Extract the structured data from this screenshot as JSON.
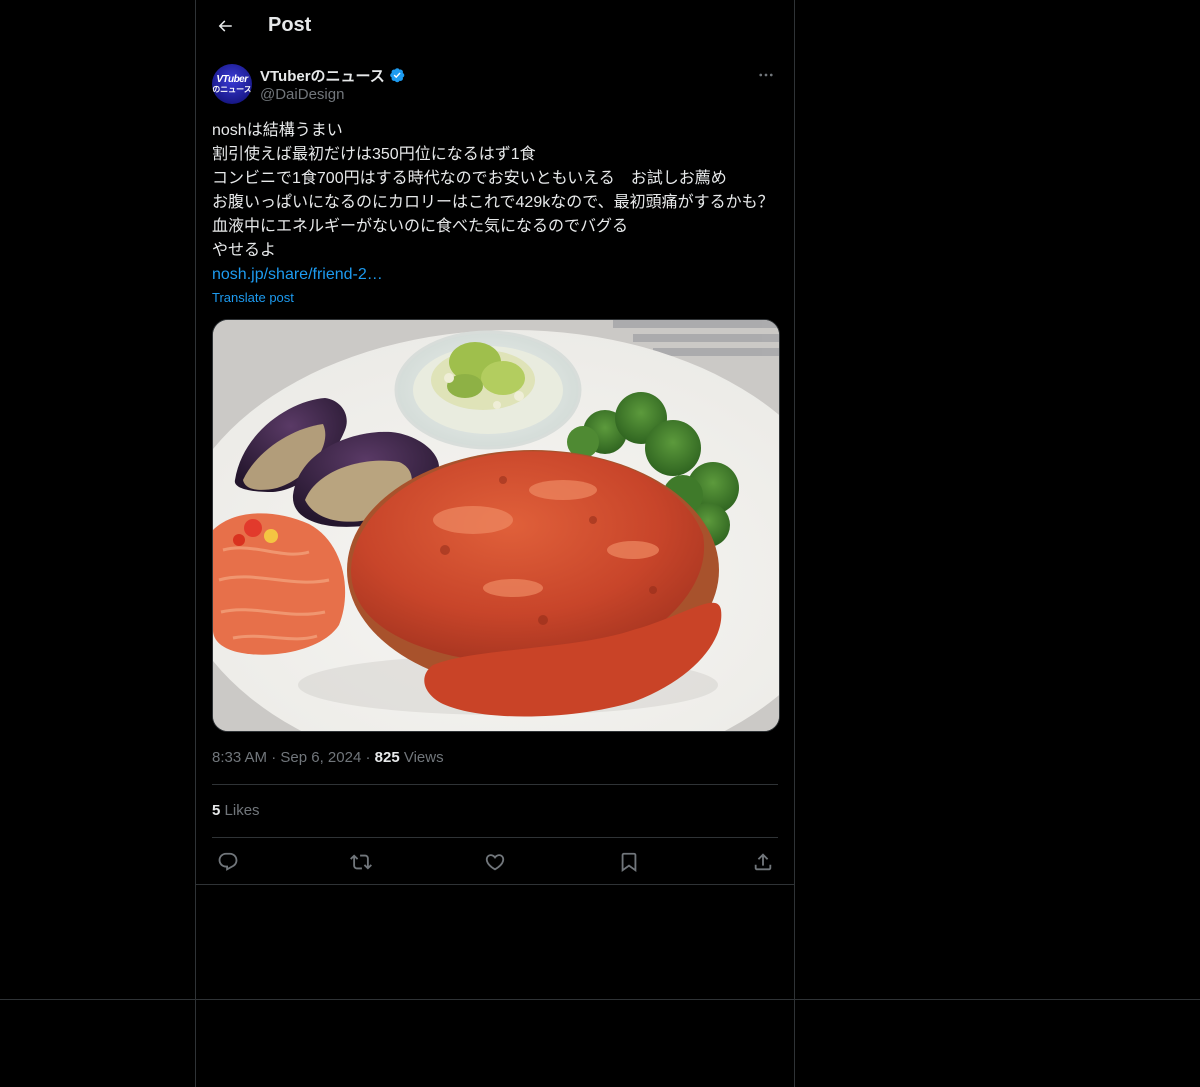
{
  "header": {
    "title": "Post",
    "back_icon": "arrow-left-icon"
  },
  "author": {
    "display_name": "VTuberのニュース",
    "handle": "@DaiDesign",
    "verified_icon": "verified-badge-icon",
    "avatar_text_line1": "VTuber",
    "avatar_text_line2": "のニュース"
  },
  "post": {
    "lines": [
      "noshは結構うまい",
      "割引使えば最初だけは350円位になるはず1食",
      "コンビニで1食700円はする時代なのでお安いともいえる　お試しお薦め",
      "お腹いっぱいになるのにカロリーはこれで429kなので、最初頭痛がするかも？血液中にエネルギーがないのに食べた気になるのでバグる",
      "やせるよ"
    ],
    "link_text": "nosh.jp/share/friend-2…",
    "translate_label": "Translate post",
    "media_alt": "hamburg steak with tomato sauce, eggplant, broccoli, carrot salad on white plate"
  },
  "meta": {
    "time": "8:33 AM",
    "date": "Sep 6, 2024",
    "views_count": "825",
    "views_label": "Views"
  },
  "stats": {
    "likes_count": "5",
    "likes_label": "Likes"
  },
  "actions": [
    {
      "name": "reply",
      "icon": "reply-icon"
    },
    {
      "name": "repost",
      "icon": "repost-icon"
    },
    {
      "name": "like",
      "icon": "heart-icon"
    },
    {
      "name": "bookmark",
      "icon": "bookmark-icon"
    },
    {
      "name": "share",
      "icon": "share-icon"
    }
  ],
  "colors": {
    "background": "#000000",
    "text": "#e7e9ea",
    "secondary": "#71767b",
    "accent": "#1d9bf0",
    "border": "#2f3336"
  }
}
